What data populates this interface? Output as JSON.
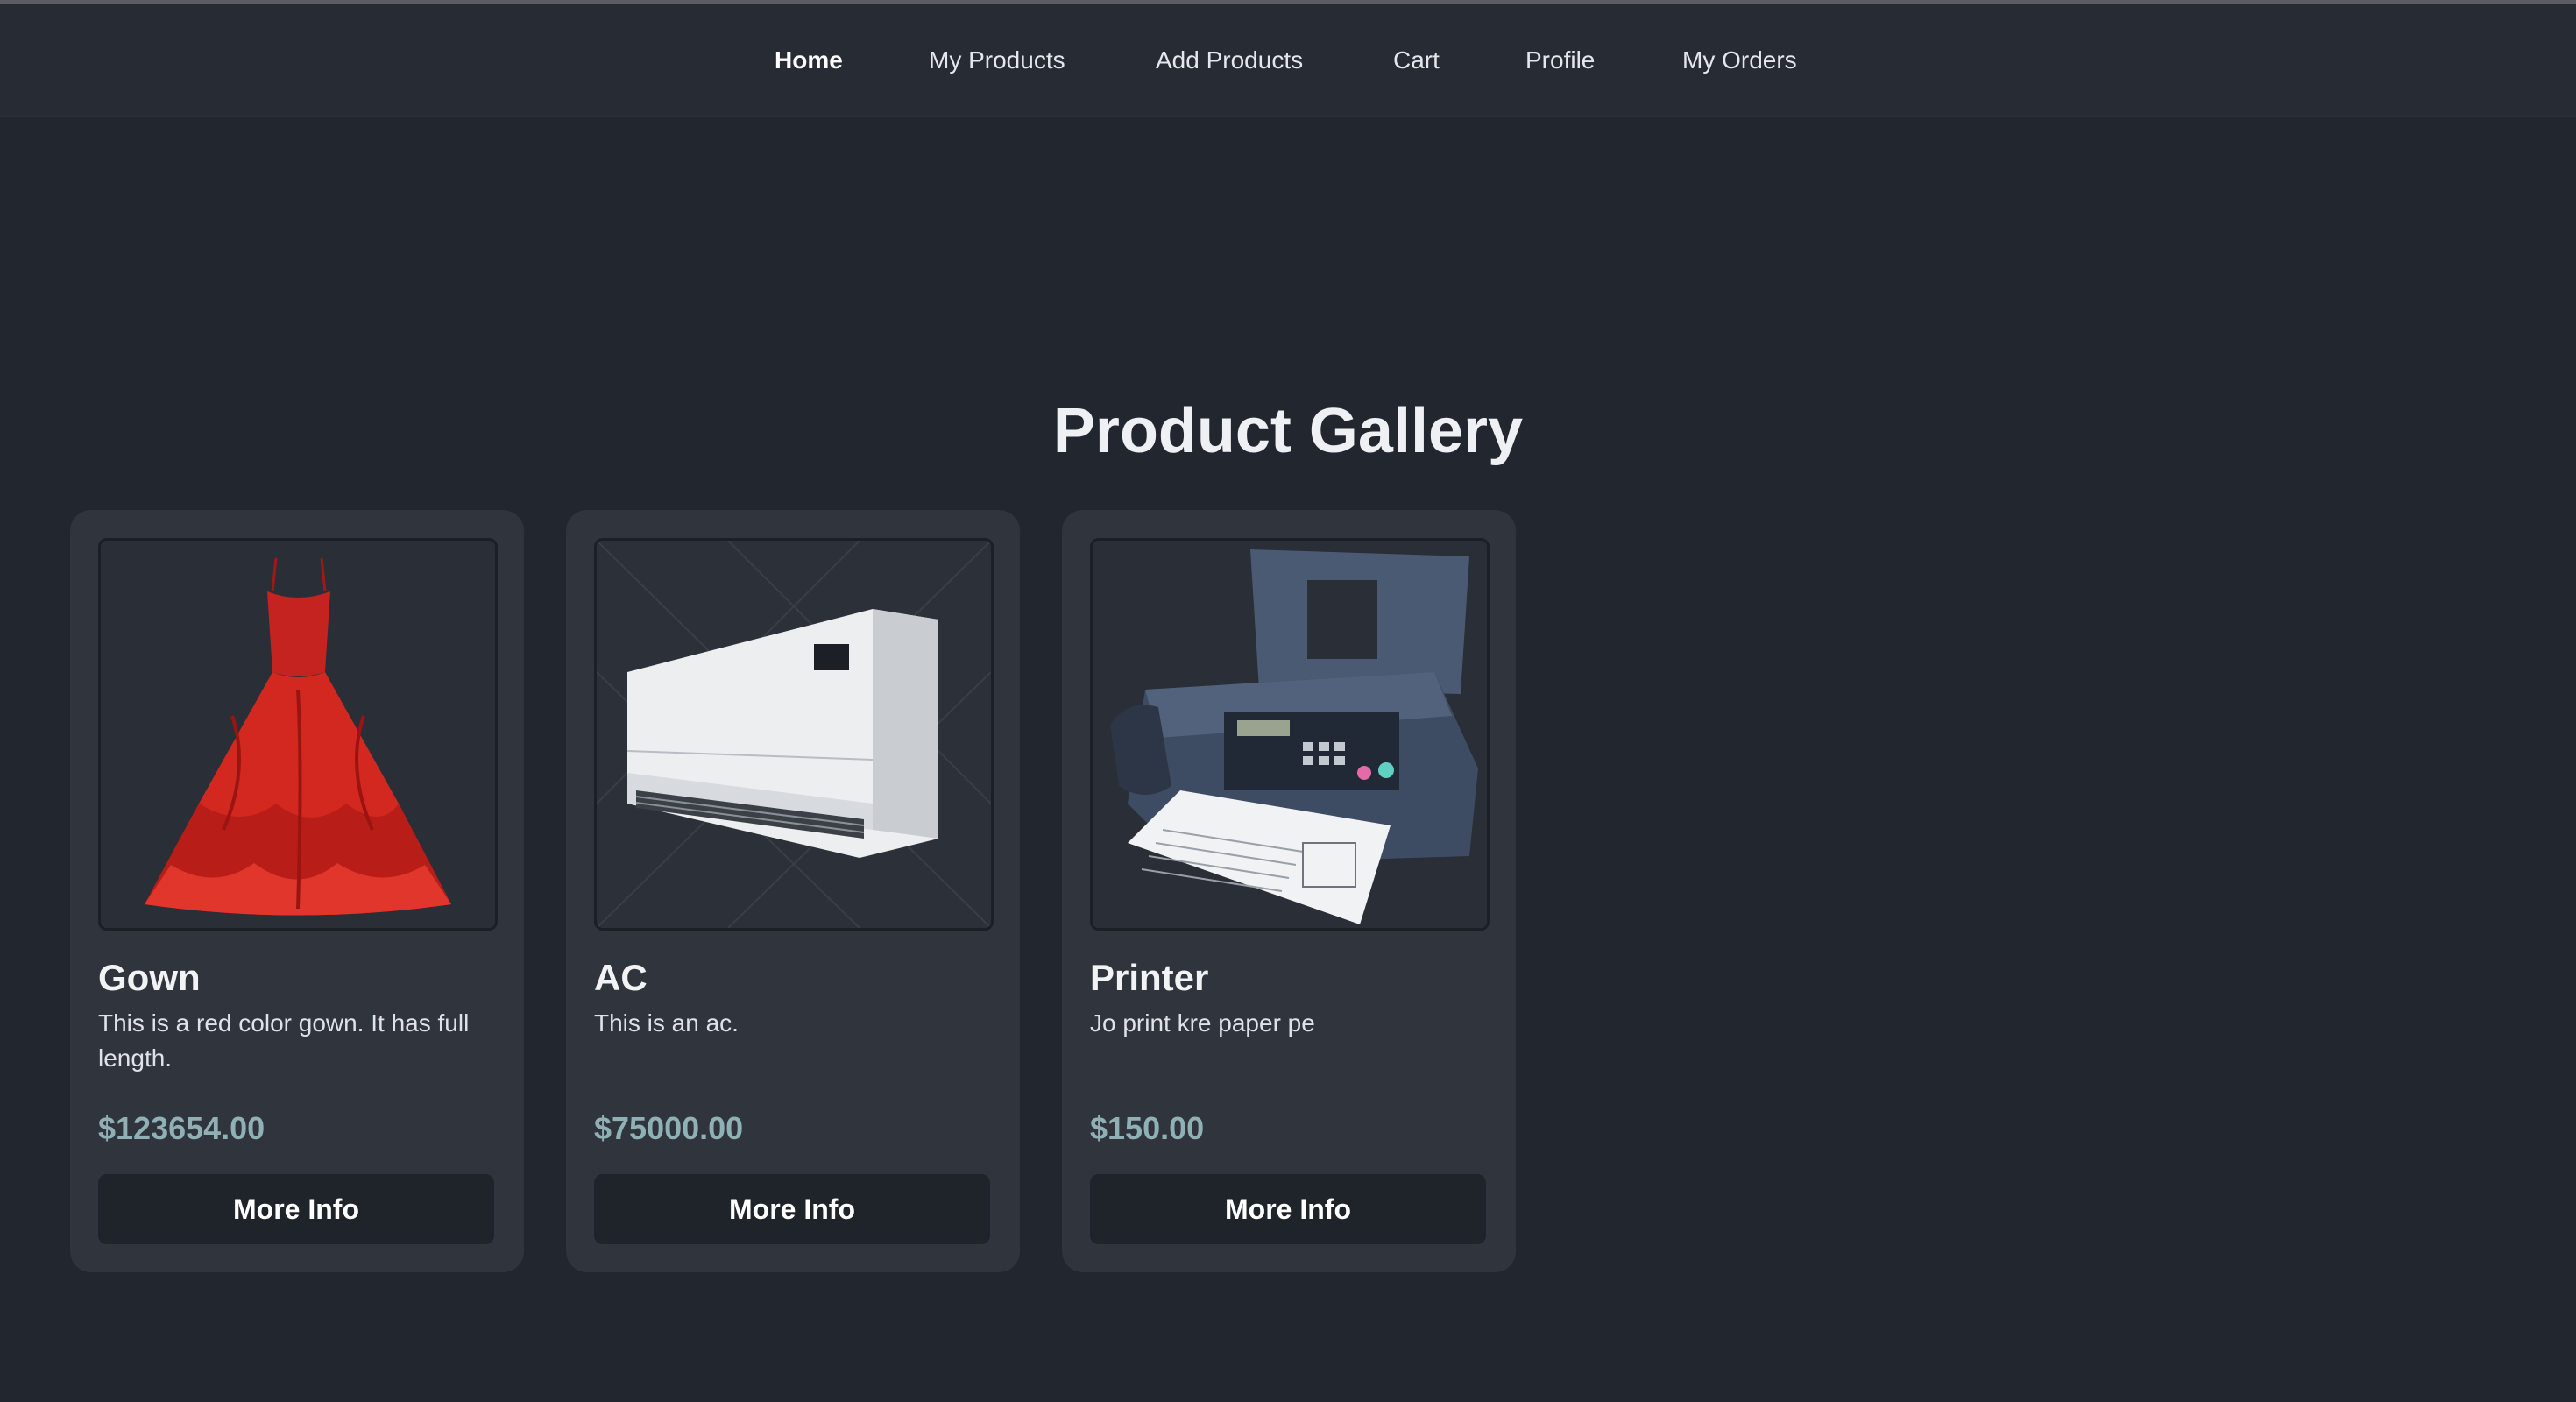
{
  "nav": {
    "items": [
      {
        "label": "Home",
        "active": true
      },
      {
        "label": "My Products",
        "active": false
      },
      {
        "label": "Add Products",
        "active": false
      },
      {
        "label": "Cart",
        "active": false
      },
      {
        "label": "Profile",
        "active": false
      },
      {
        "label": "My Orders",
        "active": false
      }
    ]
  },
  "gallery": {
    "title": "Product Gallery",
    "products": [
      {
        "name": "Gown",
        "description": "This is a red color gown. It has full length.",
        "price": "$123654.00",
        "button_label": "More Info",
        "image_icon": "red-gown-image"
      },
      {
        "name": "AC",
        "description": "This is an ac.",
        "price": "$75000.00",
        "button_label": "More Info",
        "image_icon": "air-conditioner-image"
      },
      {
        "name": "Printer",
        "description": "Jo print kre paper pe",
        "price": "$150.00",
        "button_label": "More Info",
        "image_icon": "fax-printer-image"
      }
    ]
  },
  "colors": {
    "background": "#22262e",
    "navbar": "#272b33",
    "card": "#30343d",
    "price": "#8fb0b4",
    "button": "#1f232a"
  }
}
